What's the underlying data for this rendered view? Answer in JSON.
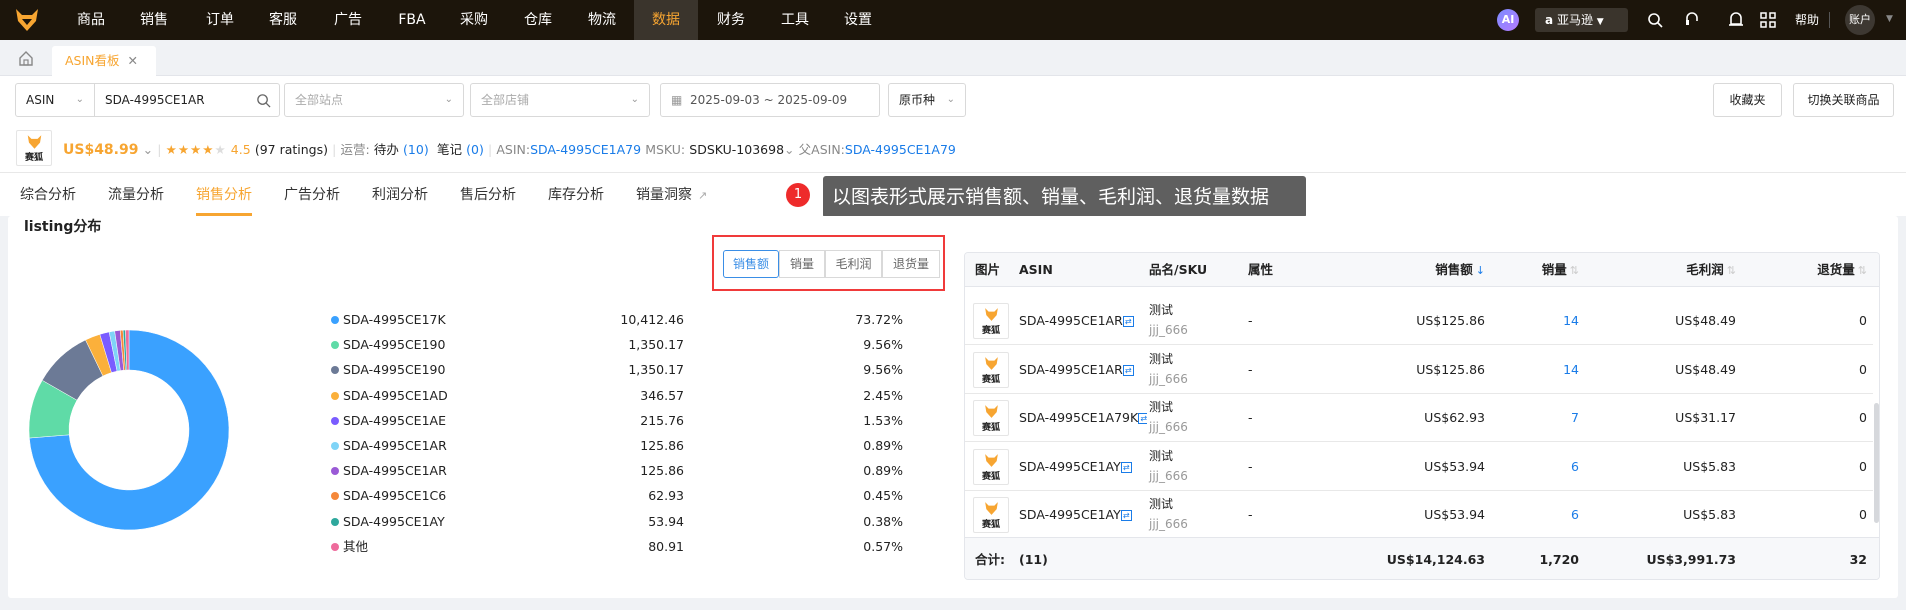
{
  "topnav": {
    "items": [
      "商品",
      "销售",
      "订单",
      "客服",
      "广告",
      "FBA",
      "采购",
      "仓库",
      "物流",
      "数据",
      "财务",
      "工具",
      "设置"
    ],
    "active": "数据",
    "ai_label": "AI",
    "marketplace": "亚马逊",
    "help": "帮助",
    "account": "账户"
  },
  "tabs": {
    "items": [
      {
        "label": "ASIN看板",
        "closable": true
      }
    ]
  },
  "filters": {
    "type_select": "ASIN",
    "search_value": "SDA-4995CE1AR",
    "site_placeholder": "全部站点",
    "shop_placeholder": "全部店铺",
    "date_start": "2025-09-03",
    "date_sep": "~",
    "date_end": "2025-09-09",
    "currency": "原币种",
    "favorites_btn": "收藏夹",
    "switch_btn": "切换关联商品"
  },
  "product": {
    "logo_text": "赛狐",
    "price": "US$48.99",
    "rating": "4.5",
    "rating_value": 4.5,
    "ratings_count": "(97 ratings)",
    "ops_label": "运营:",
    "todo_label": "待办",
    "todo_count": "(10)",
    "notes_label": "笔记",
    "notes_count": "(0)",
    "asin_label": "ASIN:",
    "asin": "SDA-4995CE1A79",
    "msku_label": "MSKU:",
    "msku": "SDSKU-103698",
    "parent_label": "父ASIN:",
    "parent_asin": "SDA-4995CE1A79"
  },
  "subtabs": {
    "items": [
      "综合分析",
      "流量分析",
      "销售分析",
      "广告分析",
      "利润分析",
      "售后分析",
      "库存分析",
      "销量洞察"
    ],
    "active": "销售分析"
  },
  "tooltip": {
    "badge": "1",
    "text": "以图表形式展示销售额、销量、毛利润、退货量数据"
  },
  "section": {
    "title": "listing分布",
    "metrics": [
      "销售额",
      "销量",
      "毛利润",
      "退货量"
    ],
    "active_metric": "销售额"
  },
  "chart_data": {
    "type": "pie",
    "donut": true,
    "legend": "right",
    "categories": [
      "SDA-4995CE17K",
      "SDA-4995CE190",
      "SDA-4995CE190",
      "SDA-4995CE1AD",
      "SDA-4995CE1AE",
      "SDA-4995CE1AR",
      "SDA-4995CE1AR",
      "SDA-4995CE1C6",
      "SDA-4995CE1AY",
      "其他"
    ],
    "values": [
      "10,412.46",
      "1,350.17",
      "1,350.17",
      "346.57",
      "215.76",
      "125.86",
      "125.86",
      "62.93",
      "53.94",
      "80.91"
    ],
    "percents": [
      "73.72%",
      "9.56%",
      "9.56%",
      "2.45%",
      "1.53%",
      "0.89%",
      "0.89%",
      "0.45%",
      "0.38%",
      "0.57%"
    ],
    "shares": [
      73.72,
      9.56,
      9.56,
      2.45,
      1.53,
      0.89,
      0.89,
      0.45,
      0.38,
      0.57
    ],
    "colors": [
      "#3aa1ff",
      "#5fdba7",
      "#6c7a96",
      "#fbb03b",
      "#7a5cff",
      "#7fd4f7",
      "#9a5ad6",
      "#f5883a",
      "#2ea89d",
      "#ee6b9c"
    ]
  },
  "table": {
    "headers": [
      "图片",
      "ASIN",
      "品名/SKU",
      "属性",
      "销售额",
      "销量",
      "毛利润",
      "退货量"
    ],
    "rows": [
      {
        "img": "赛狐",
        "asin": "SDA-4995CE1AR",
        "name": "测试",
        "sku": "jjj_666",
        "attr": "-",
        "sales": "US$125.86",
        "qty": "14",
        "profit": "US$48.49",
        "returns": "0"
      },
      {
        "img": "赛狐",
        "asin": "SDA-4995CE1AR",
        "name": "测试",
        "sku": "jjj_666",
        "attr": "-",
        "sales": "US$125.86",
        "qty": "14",
        "profit": "US$48.49",
        "returns": "0"
      },
      {
        "img": "赛狐",
        "asin": "SDA-4995CE1A79K",
        "name": "测试",
        "sku": "jjj_666",
        "attr": "-",
        "sales": "US$62.93",
        "qty": "7",
        "profit": "US$31.17",
        "returns": "0"
      },
      {
        "img": "赛狐",
        "asin": "SDA-4995CE1AY",
        "name": "测试",
        "sku": "jjj_666",
        "attr": "-",
        "sales": "US$53.94",
        "qty": "6",
        "profit": "US$5.83",
        "returns": "0"
      },
      {
        "img": "赛狐",
        "asin": "SDA-4995CE1AY",
        "name": "测试",
        "sku": "jjj_666",
        "attr": "-",
        "sales": "US$53.94",
        "qty": "6",
        "profit": "US$5.83",
        "returns": "0"
      }
    ],
    "footer": {
      "label": "合计:",
      "count": "(11)",
      "sales": "US$14,124.63",
      "qty": "1,720",
      "profit": "US$3,991.73",
      "returns": "32"
    }
  },
  "colors": {
    "brand": "#f7a531",
    "link": "#1a7ce8",
    "highlight_box": "#f03a3a"
  }
}
